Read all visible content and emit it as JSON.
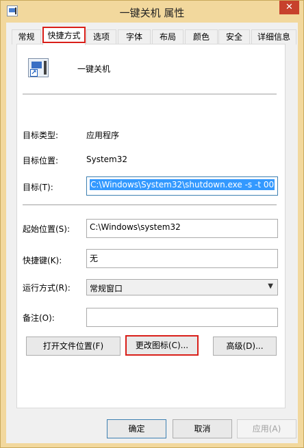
{
  "window": {
    "title": "一键关机 属性",
    "close_label": "✕"
  },
  "tabs": [
    {
      "label": "常规"
    },
    {
      "label": "快捷方式"
    },
    {
      "label": "选项"
    },
    {
      "label": "字体"
    },
    {
      "label": "布局"
    },
    {
      "label": "颜色"
    },
    {
      "label": "安全"
    },
    {
      "label": "详细信息"
    }
  ],
  "shortcut": {
    "name": "一键关机",
    "target_type_label": "目标类型:",
    "target_type_value": "应用程序",
    "target_location_label": "目标位置:",
    "target_location_value": "System32",
    "target_label": "目标(T):",
    "target_value": "C:\\Windows\\System32\\shutdown.exe -s -t 00",
    "start_in_label": "起始位置(S):",
    "start_in_value": "C:\\Windows\\system32",
    "shortcut_key_label": "快捷键(K):",
    "shortcut_key_value": "无",
    "run_label": "运行方式(R):",
    "run_value": "常规窗口",
    "comment_label": "备注(O):",
    "comment_value": "",
    "open_location_button": "打开文件位置(F)",
    "change_icon_button": "更改图标(C)...",
    "advanced_button": "高级(D)..."
  },
  "footer": {
    "ok": "确定",
    "cancel": "取消",
    "apply": "应用(A)"
  },
  "colors": {
    "frame": "#f2d89d",
    "highlight_box": "#d91e18",
    "selection": "#3399ff",
    "close": "#c7412c"
  }
}
